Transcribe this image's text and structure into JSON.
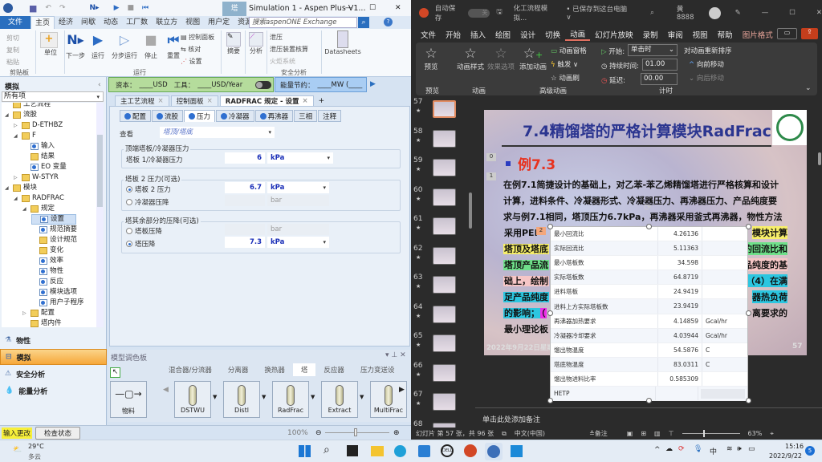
{
  "aspen": {
    "title": "Simulation 1 - Aspen Plus V1...",
    "ribbon_context_tab": "塔",
    "menu": [
      "文件",
      "主页",
      "经济",
      "间歇",
      "动态",
      "工厂数",
      "联立方",
      "视图",
      "用户定",
      "资源",
      "塔设计"
    ],
    "active_menu": 1,
    "search_placeholder": "搜索aspenONE Exchange",
    "ribbon": {
      "clipboard": [
        "剪切",
        "复制",
        "粘贴"
      ],
      "clipboard_group": "剪贴板",
      "units": "单位",
      "run_buttons": [
        "下一步",
        "运行",
        "分步运行",
        "停止",
        "重置"
      ],
      "run_side": [
        "控制面板",
        "核对",
        "设置"
      ],
      "run_group": "运行",
      "summary": "摘要",
      "analysis": "分析",
      "safety": [
        "泄压",
        "泄压装置核算",
        "火炬系统"
      ],
      "safety_group": "安全分析",
      "datasheets": "Datasheets"
    },
    "econ_bar": {
      "capital": "资本：",
      "capital_val": "____USD",
      "utility": "工具：",
      "utility_val": "____USD/Year",
      "energy": "能量节约：",
      "energy_val": "____MW  (____"
    },
    "sidebar": {
      "title": "模拟",
      "filter": "所有项",
      "tree": [
        {
          "label": "工艺流程",
          "lvl": 1,
          "ico": "folder"
        },
        {
          "label": "流股",
          "lvl": 1,
          "ico": "folder",
          "exp": "◢"
        },
        {
          "label": "D-ETHBZ",
          "lvl": 2,
          "ico": "folder",
          "exp": "▷"
        },
        {
          "label": "F",
          "lvl": 2,
          "ico": "folder",
          "exp": "◢"
        },
        {
          "label": "输入",
          "lvl": 3,
          "ico": "form"
        },
        {
          "label": "结果",
          "lvl": 3,
          "ico": "folder"
        },
        {
          "label": "EO 变量",
          "lvl": 3,
          "ico": "form"
        },
        {
          "label": "W-STYR",
          "lvl": 2,
          "ico": "folder",
          "exp": "▷"
        },
        {
          "label": "模块",
          "lvl": 1,
          "ico": "folder",
          "exp": "◢"
        },
        {
          "label": "RADFRAC",
          "lvl": 2,
          "ico": "folder",
          "exp": "◢"
        },
        {
          "label": "规定",
          "lvl": 3,
          "ico": "folder",
          "exp": "◢"
        },
        {
          "label": "设置",
          "lvl": 4,
          "ico": "form",
          "sel": true
        },
        {
          "label": "规范摘要",
          "lvl": 4,
          "ico": "form"
        },
        {
          "label": "设计规范",
          "lvl": 4,
          "ico": "folder"
        },
        {
          "label": "变化",
          "lvl": 4,
          "ico": "folder"
        },
        {
          "label": "效率",
          "lvl": 4,
          "ico": "form"
        },
        {
          "label": "物性",
          "lvl": 4,
          "ico": "form"
        },
        {
          "label": "反应",
          "lvl": 4,
          "ico": "form"
        },
        {
          "label": "模块选项",
          "lvl": 4,
          "ico": "form"
        },
        {
          "label": "用户子程序",
          "lvl": 4,
          "ico": "form"
        },
        {
          "label": "配置",
          "lvl": 3,
          "ico": "folder",
          "exp": "▷"
        },
        {
          "label": "塔内件",
          "lvl": 3,
          "ico": "folder"
        }
      ],
      "nav": [
        "物性",
        "模拟",
        "安全分析",
        "能量分析"
      ],
      "nav_active": 1
    },
    "doc_tabs": [
      "主工艺流程",
      "控制面板",
      "RADFRAC 规定 - 设置"
    ],
    "form_tabs": [
      "配置",
      "流股",
      "压力",
      "冷凝器",
      "再沸器",
      "三相",
      "注释"
    ],
    "form_active": 2,
    "form": {
      "view_label": "查看",
      "view_value": "塔顶/塔底",
      "g1": "顶端塔板/冷凝器压力",
      "g1_field": "塔板 1/冷凝器压力",
      "g1_val": "6",
      "g1_unit": "kPa",
      "g2": "塔板 2 压力(可选)",
      "g2_opt1": "塔板 2 压力",
      "g2_val": "6.7",
      "g2_unit": "kPa",
      "g2_opt2": "冷凝器压降",
      "g2_unit2": "bar",
      "g3": "塔其余部分的压降(可选)",
      "g3_opt1": "塔板压降",
      "g3_unit1": "bar",
      "g3_opt2": "塔压降",
      "g3_val": "7.3",
      "g3_unit2": "kPa"
    },
    "palette": {
      "title": "模型调色板",
      "tabs": [
        "混合器/分流器",
        "分离器",
        "换热器",
        "塔",
        "反应器",
        "压力变送设"
      ],
      "active_tab": 3,
      "stream": "物料",
      "models": [
        "DSTWU",
        "Distl",
        "RadFrac",
        "Extract",
        "MultiFrac"
      ]
    },
    "status": {
      "input_changed": "输入更改",
      "check_status": "检查状态",
      "zoom": "100%"
    }
  },
  "ppt": {
    "autosave": "自动保存",
    "autosave_state": "关",
    "filename": "化工流程模拟...",
    "saved": "• 已保存到这台电脑 ∨",
    "user": "黄 8888",
    "menu": [
      "文件",
      "开始",
      "插入",
      "绘图",
      "设计",
      "切换",
      "动画",
      "幻灯片放映",
      "录制",
      "审阅",
      "视图",
      "帮助",
      "图片格式"
    ],
    "active_menu": 6,
    "ribbon": {
      "preview": "预览",
      "anim_style": "动画样式",
      "effect": "效果选项",
      "add_anim": "添加动画",
      "anim_pane": "动画窗格",
      "trigger": "触发 ∨",
      "painter": "动画刷",
      "start_lbl": "开始:",
      "start_val": "单击时",
      "duration_lbl": "持续时间:",
      "duration_val": "01.00",
      "delay_lbl": "延迟:",
      "delay_val": "00.00",
      "reorder": "对动画重新排序",
      "forward": "向前移动",
      "backward": "向后移动",
      "groups": [
        "预览",
        "动画",
        "高级动画",
        "计时"
      ]
    },
    "thumbs": [
      "57",
      "58",
      "59",
      "60",
      "61",
      "62",
      "63",
      "64",
      "65",
      "66",
      "67",
      "68"
    ],
    "slide": {
      "title": "7.4精馏塔的严格计算模块RadFrac",
      "example": "例7.3",
      "lines": [
        "在例7.1简捷设计的基础上，对乙苯-苯乙烯精馏塔进行严格核算和设计",
        "计算，进料条件、冷凝器形式、冷凝器压力、再沸器压力、产品纯度要",
        "求与例7.1相同，塔顶压力6.7kPa，再沸器采用釜式再沸器，物性方法"
      ],
      "left_frag": [
        "采用PEI",
        "塔顶及塔底",
        "塔顶产品流",
        "础上，绘制",
        "足产品纯度",
        "的影响；",
        "最小理论板"
      ],
      "left_extra": "（",
      "right_frag": [
        "模块计算",
        "的回流比和",
        "品纯度的基",
        "（4）在满",
        "器热负荷",
        "离要求的",
        ""
      ],
      "colors": {
        "yellow": "#f7ef6a",
        "green": "#6fe08a",
        "pink": "#f6c6c6",
        "cyan": "#2cc6e0",
        "magenta": "#ee2ee8",
        "example": "#e8321e",
        "title": "#2b3590"
      },
      "footer_date": "2022年9月22日星期",
      "page": "57",
      "anim_tags": [
        "0",
        "1",
        "2"
      ],
      "table": [
        [
          "最小回流比",
          "4.26136",
          ""
        ],
        [
          "实际回流比",
          "5.11363",
          ""
        ],
        [
          "最小塔板数",
          "34.598",
          ""
        ],
        [
          "实际塔板数",
          "64.8719",
          ""
        ],
        [
          "进料塔板",
          "24.9419",
          ""
        ],
        [
          "进料上方实际塔板数",
          "23.9419",
          ""
        ],
        [
          "再沸器加热要求",
          "4.14859",
          "Gcal/hr"
        ],
        [
          "冷凝器冷却要求",
          "4.03944",
          "Gcal/hr"
        ],
        [
          "馏出物温度",
          "54.5876",
          "C"
        ],
        [
          "塔底物温度",
          "83.0311",
          "C"
        ],
        [
          "馏出物进料比率",
          "0.585309",
          ""
        ],
        [
          "HETP",
          "",
          ""
        ]
      ]
    },
    "notes_placeholder": "单击此处添加备注",
    "status": {
      "slide_info": "幻灯片 第 57 张，共 96 张",
      "language": "中文(中国)",
      "notes": "≙备注",
      "zoom": "63%"
    }
  },
  "taskbar": {
    "temp": "29°C",
    "weather": "多云",
    "ime": "中",
    "time": "15:16",
    "date": "2022/9/22",
    "badge": "5"
  }
}
